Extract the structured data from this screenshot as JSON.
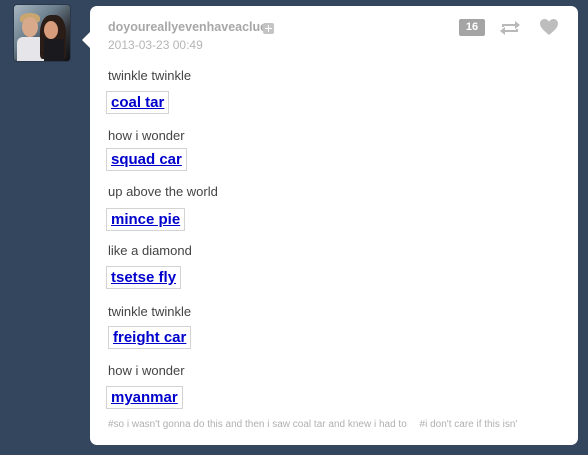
{
  "post": {
    "username": "doyoureallyevenhaveaclue",
    "timestamp": "2013-03-23 00:49",
    "notes": "16",
    "lines": [
      {
        "text": "twinkle twinkle",
        "link": "coal tar"
      },
      {
        "text": "how i wonder",
        "link": "squad car"
      },
      {
        "text": "up above the world",
        "link": "mince pie"
      },
      {
        "text": "like a diamond",
        "link": "tsetse fly"
      },
      {
        "text": "twinkle twinkle",
        "link": "freight car"
      },
      {
        "text": "how i wonder",
        "link": "myanmar"
      }
    ],
    "tags": [
      "#so i wasn't gonna do this and then i saw coal tar and knew i had to",
      "#i don't care if this isn'"
    ]
  },
  "icons": {
    "follow": "plus-icon",
    "reblog": "reblog-icon",
    "like": "heart-icon"
  }
}
